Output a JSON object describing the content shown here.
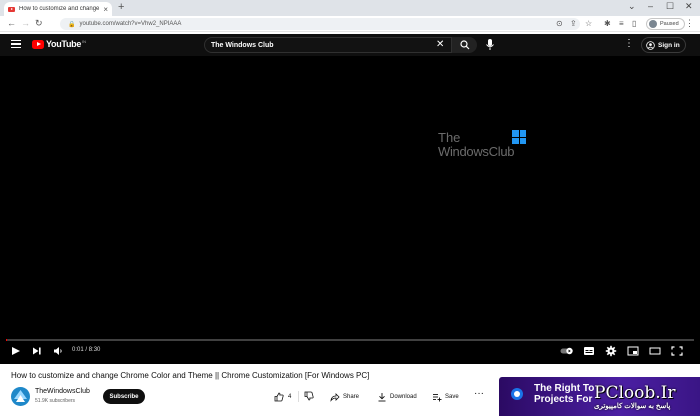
{
  "browser": {
    "tab_title": "How to customize and change C",
    "tab_close": "×",
    "new_tab": "+",
    "url": "youtube.com/watch?v=Vhw2_NPIAAA",
    "profile_label": "Paused",
    "window_controls": {
      "dropdown": "⌄",
      "minimize": "–",
      "maximize": "☐",
      "close": "✕"
    }
  },
  "masthead": {
    "logo_text": "YouTube",
    "country_code": "IN",
    "search_query": "The Windows Club",
    "signin_label": "Sign in"
  },
  "video": {
    "watermark_line1": "The",
    "watermark_line2": "WindowsClub",
    "progress": 0.002,
    "current_time": "0:01",
    "duration": "8:30",
    "time_separator": "/"
  },
  "below": {
    "title": "How to customize and change Chrome Color and Theme || Chrome Customization [For Windows PC]",
    "channel_name": "TheWindowsClub",
    "channel_subs": "51.9K subscribers",
    "subscribe_label": "Subscribe",
    "like_count": "4",
    "share_label": "Share",
    "download_label": "Download",
    "save_label": "Save",
    "more_label": "···"
  },
  "ad": {
    "line1": "The Right To",
    "line2": "Projects For"
  },
  "site_watermark": {
    "line1": "PCloob.Ir",
    "line2": "پاسخ به سوالات کامپیوتری"
  },
  "colors": {
    "yt_red": "#ff0000",
    "masthead_bg": "#0f0f0f",
    "ad_purple": "#4b1fa3"
  }
}
